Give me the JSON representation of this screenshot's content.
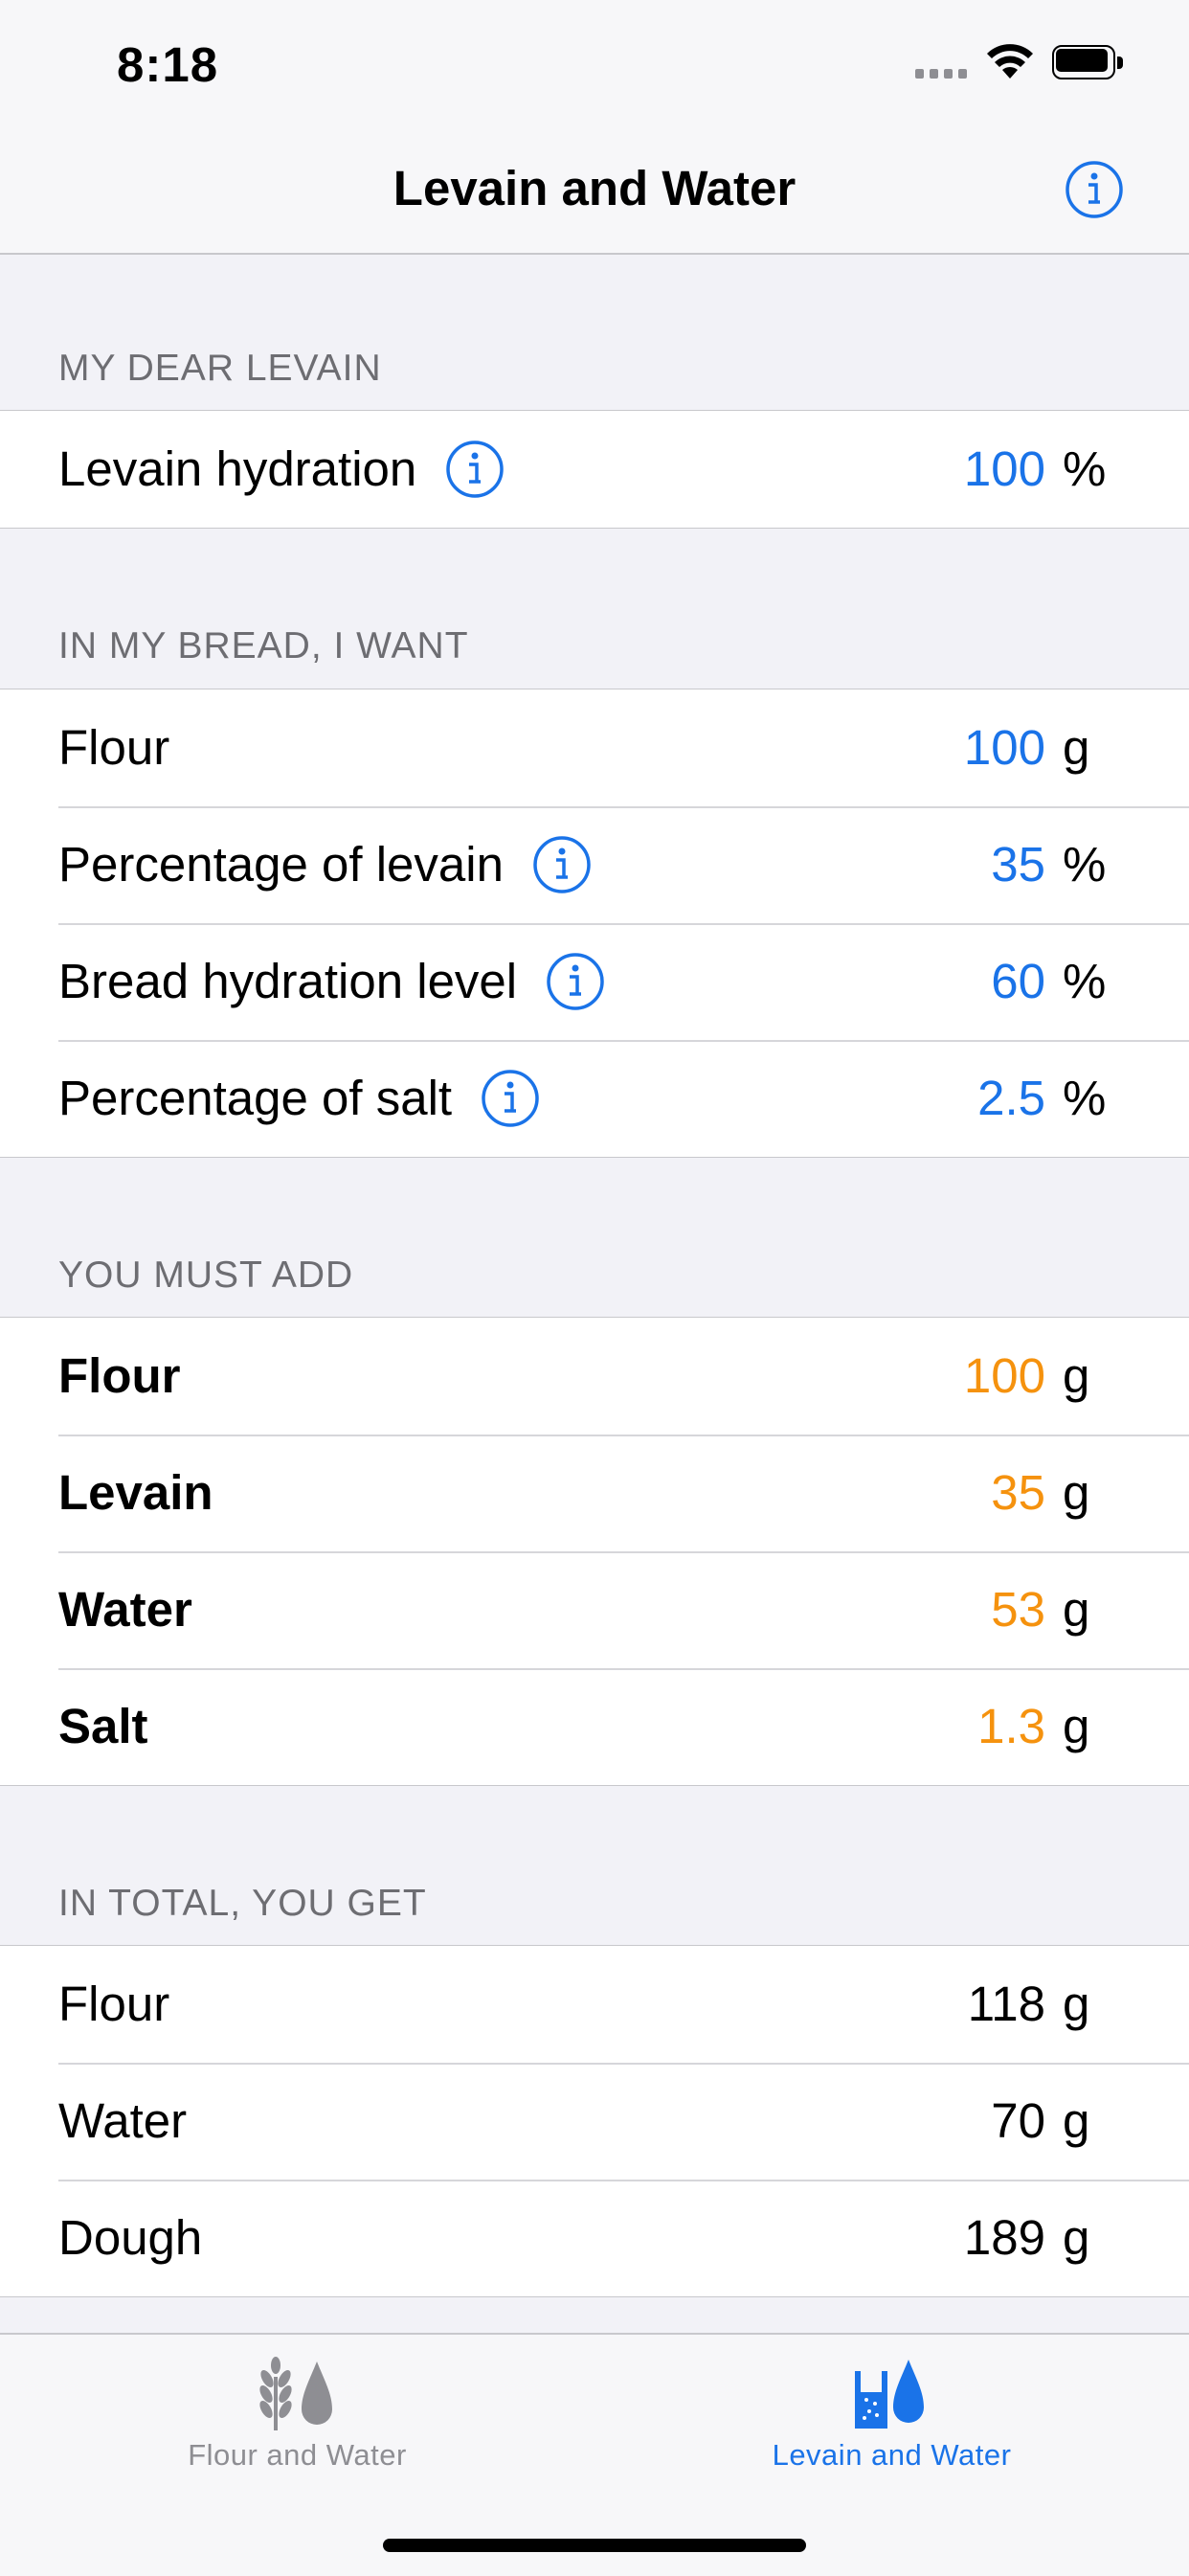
{
  "status_bar": {
    "time": "8:18"
  },
  "nav": {
    "title": "Levain and Water"
  },
  "colors": {
    "accent": "#1a73e8",
    "result": "#f5920e",
    "inactive": "#8e8e93"
  },
  "sections": {
    "levain": {
      "header": "MY DEAR LEVAIN",
      "rows": [
        {
          "label": "Levain hydration",
          "value": "100",
          "unit": "%"
        }
      ]
    },
    "want": {
      "header": "IN MY BREAD, I WANT",
      "rows": [
        {
          "label": "Flour",
          "value": "100",
          "unit": "g"
        },
        {
          "label": "Percentage of levain",
          "value": "35",
          "unit": "%"
        },
        {
          "label": "Bread hydration level",
          "value": "60",
          "unit": "%"
        },
        {
          "label": "Percentage of salt",
          "value": "2.5",
          "unit": "%"
        }
      ]
    },
    "add": {
      "header": "YOU MUST ADD",
      "rows": [
        {
          "label": "Flour",
          "value": "100",
          "unit": "g"
        },
        {
          "label": "Levain",
          "value": "35",
          "unit": "g"
        },
        {
          "label": "Water",
          "value": "53",
          "unit": "g"
        },
        {
          "label": "Salt",
          "value": "1.3",
          "unit": "g"
        }
      ]
    },
    "total": {
      "header": "IN TOTAL, YOU GET",
      "rows": [
        {
          "label": "Flour",
          "value": "118",
          "unit": "g"
        },
        {
          "label": "Water",
          "value": "70",
          "unit": "g"
        },
        {
          "label": "Dough",
          "value": "189",
          "unit": "g"
        }
      ]
    }
  },
  "tabs": [
    {
      "label": "Flour and Water",
      "icon": "wheat-drop-icon",
      "selected": false
    },
    {
      "label": "Levain and Water",
      "icon": "glass-drop-icon",
      "selected": true
    }
  ]
}
